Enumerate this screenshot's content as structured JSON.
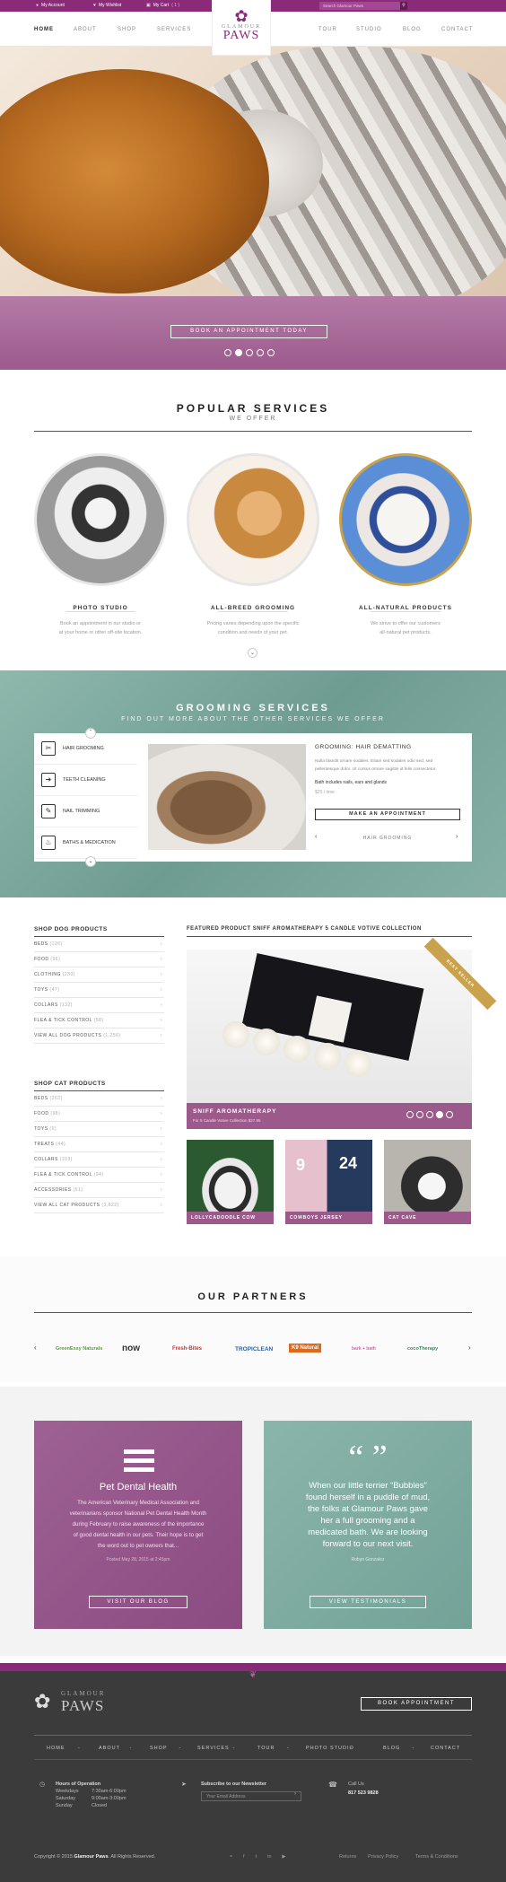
{
  "topbar": {
    "my_account": "My Account",
    "my_wishlist": "My Wishlist",
    "my_cart": "My Cart",
    "cart_count": "( 1 )",
    "search_placeholder": "Search Glamour Paws"
  },
  "nav": {
    "left": [
      "HOME",
      "ABOUT",
      "SHOP",
      "SERVICES"
    ],
    "right": [
      "TOUR",
      "STUDIO",
      "BLOG",
      "CONTACT"
    ]
  },
  "logo": {
    "line1": "GLAMOUR",
    "line2": "PAWS"
  },
  "hero": {
    "book_button": "BOOK AN APPOINTMENT TODAY",
    "slides": 5,
    "active_slide": 2
  },
  "popular": {
    "title": "POPULAR SERVICES",
    "subtitle": "WE OFFER",
    "services": [
      {
        "title": "PHOTO STUDIO",
        "desc1": "Book an appointment in our studio or",
        "desc2": "at your home or other off-site location."
      },
      {
        "title": "ALL-BREED GROOMING",
        "desc1": "Pricing varies depending upon the specific",
        "desc2": "condition and needs of your pet."
      },
      {
        "title": "ALL-NATURAL PRODUCTS",
        "desc1": "We strive to offer our customers",
        "desc2": "all-natural pet products."
      }
    ]
  },
  "grooming": {
    "title": "GROOMING SERVICES",
    "subtitle": "FIND OUT MORE ABOUT THE OTHER SERVICES WE OFFER",
    "items": [
      "HAIR GROOMING",
      "TEETH CLEANING",
      "NAIL TRIMMING",
      "BATHS & MEDICATION"
    ],
    "detail_title": "GROOMING: HAIR DEMATTING",
    "detail_text1": "Nulla blandit ornare sodales. Etiam sed sodales odio sed, sed",
    "detail_text2": "pellentesque dolor. Ut cursus ornare sagittis id felis consectetur.",
    "detail_note": "Bath includes nails, ears and glands",
    "detail_price": "$25 / time",
    "appointment_button": "MAKE AN APPOINTMENT",
    "pager_label": "HAIR GROOMING"
  },
  "shop_dog": {
    "title": "SHOP DOG PRODUCTS",
    "items": [
      {
        "label": "BEDS",
        "count": "(126)"
      },
      {
        "label": "FOOD",
        "count": "(96)"
      },
      {
        "label": "CLOTHING",
        "count": "(230)"
      },
      {
        "label": "TOYS",
        "count": "(47)"
      },
      {
        "label": "COLLARS",
        "count": "(132)"
      },
      {
        "label": "FLEA & TICK CONTROL",
        "count": "(58)"
      },
      {
        "label": "VIEW ALL DOG PRODUCTS",
        "count": "(1,256)"
      }
    ]
  },
  "shop_cat": {
    "title": "SHOP CAT PRODUCTS",
    "items": [
      {
        "label": "BEDS",
        "count": "(262)"
      },
      {
        "label": "FOOD",
        "count": "(98)"
      },
      {
        "label": "TOYS",
        "count": "(0)"
      },
      {
        "label": "TREATS",
        "count": "(44)"
      },
      {
        "label": "COLLARS",
        "count": "(103)"
      },
      {
        "label": "FLEA & TICK CONTROL",
        "count": "(94)"
      },
      {
        "label": "ACCESSORIES",
        "count": "(51)"
      },
      {
        "label": "VIEW ALL CAT PRODUCTS",
        "count": "(3,822)"
      }
    ]
  },
  "featured": {
    "title": "FEATURED PRODUCT SNIFF AROMATHERAPY 5 CANDLE VOTIVE COLLECTION",
    "ribbon": "BEST SELLER",
    "name": "SNIFF AROMATHERAPY",
    "sub": "For 5 Candle Votive Collection  $37.95",
    "slides": 5,
    "active_slide": 4,
    "thumbs": [
      "LOLLYCADOODLE COW",
      "COWBOYS JERSEY",
      "CAT CAVE"
    ]
  },
  "partners": {
    "title": "OUR PARTNERS",
    "logos": [
      "GreenEssy Naturals",
      "now",
      "Fresh-Bites",
      "TROPICLEAN",
      "K9 Natural",
      "bark + bath",
      "cocoTherapy"
    ]
  },
  "blog": {
    "title": "Pet Dental Health",
    "text": [
      "The American Veterinary Medical Association and",
      "veterinarians sponsor National Pet Dental Health Month",
      "during February to raise awareness of the importance",
      "of good dental health in our pets. Their hope is to get",
      "the word out to pet owners that..."
    ],
    "date": "Posted May 28, 2015 at 2:45pm",
    "button": "VISIT OUR BLOG"
  },
  "testimonial": {
    "quote": [
      "When our little terrier “Bubbles”",
      "found herself in a puddle of mud,",
      "the folks at Glamour Paws gave",
      "her a full grooming and a",
      "medicated bath. We are looking",
      "forward to our next visit."
    ],
    "author": "Robyn Gonzalez",
    "button": "VIEW TESTIMONIALS"
  },
  "footer": {
    "logo1": "GLAMOUR",
    "logo2": "PAWS",
    "book_button": "BOOK APPOINTMENT",
    "nav": [
      "HOME",
      "ABOUT",
      "SHOP",
      "SERVICES",
      "TOUR",
      "PHOTO STUDIO",
      "BLOG",
      "CONTACT"
    ],
    "hours_title": "Hours of Operation",
    "hours": [
      [
        "Weekdays",
        "7:30am-6:00pm"
      ],
      [
        "Saturday",
        "9:00am-3:00pm"
      ],
      [
        "Sunday",
        "Closed"
      ]
    ],
    "newsletter_title": "Subscribe to our Newsletter",
    "newsletter_placeholder": "Your Email Address",
    "call_title": "Call Us",
    "phone": "817 523 9828",
    "copyright_pre": "Copyright © 2015",
    "copyright_brand": "Glamour Paws",
    "copyright_post": ". All Rights Reserved.",
    "links": [
      "Returns",
      "Privacy Policy",
      "Terms & Conditions"
    ]
  },
  "colors": {
    "brand": "#8a2a78",
    "mauve": "#9c5a8c",
    "teal": "#7fa89d",
    "footer": "#3b3b3b"
  }
}
